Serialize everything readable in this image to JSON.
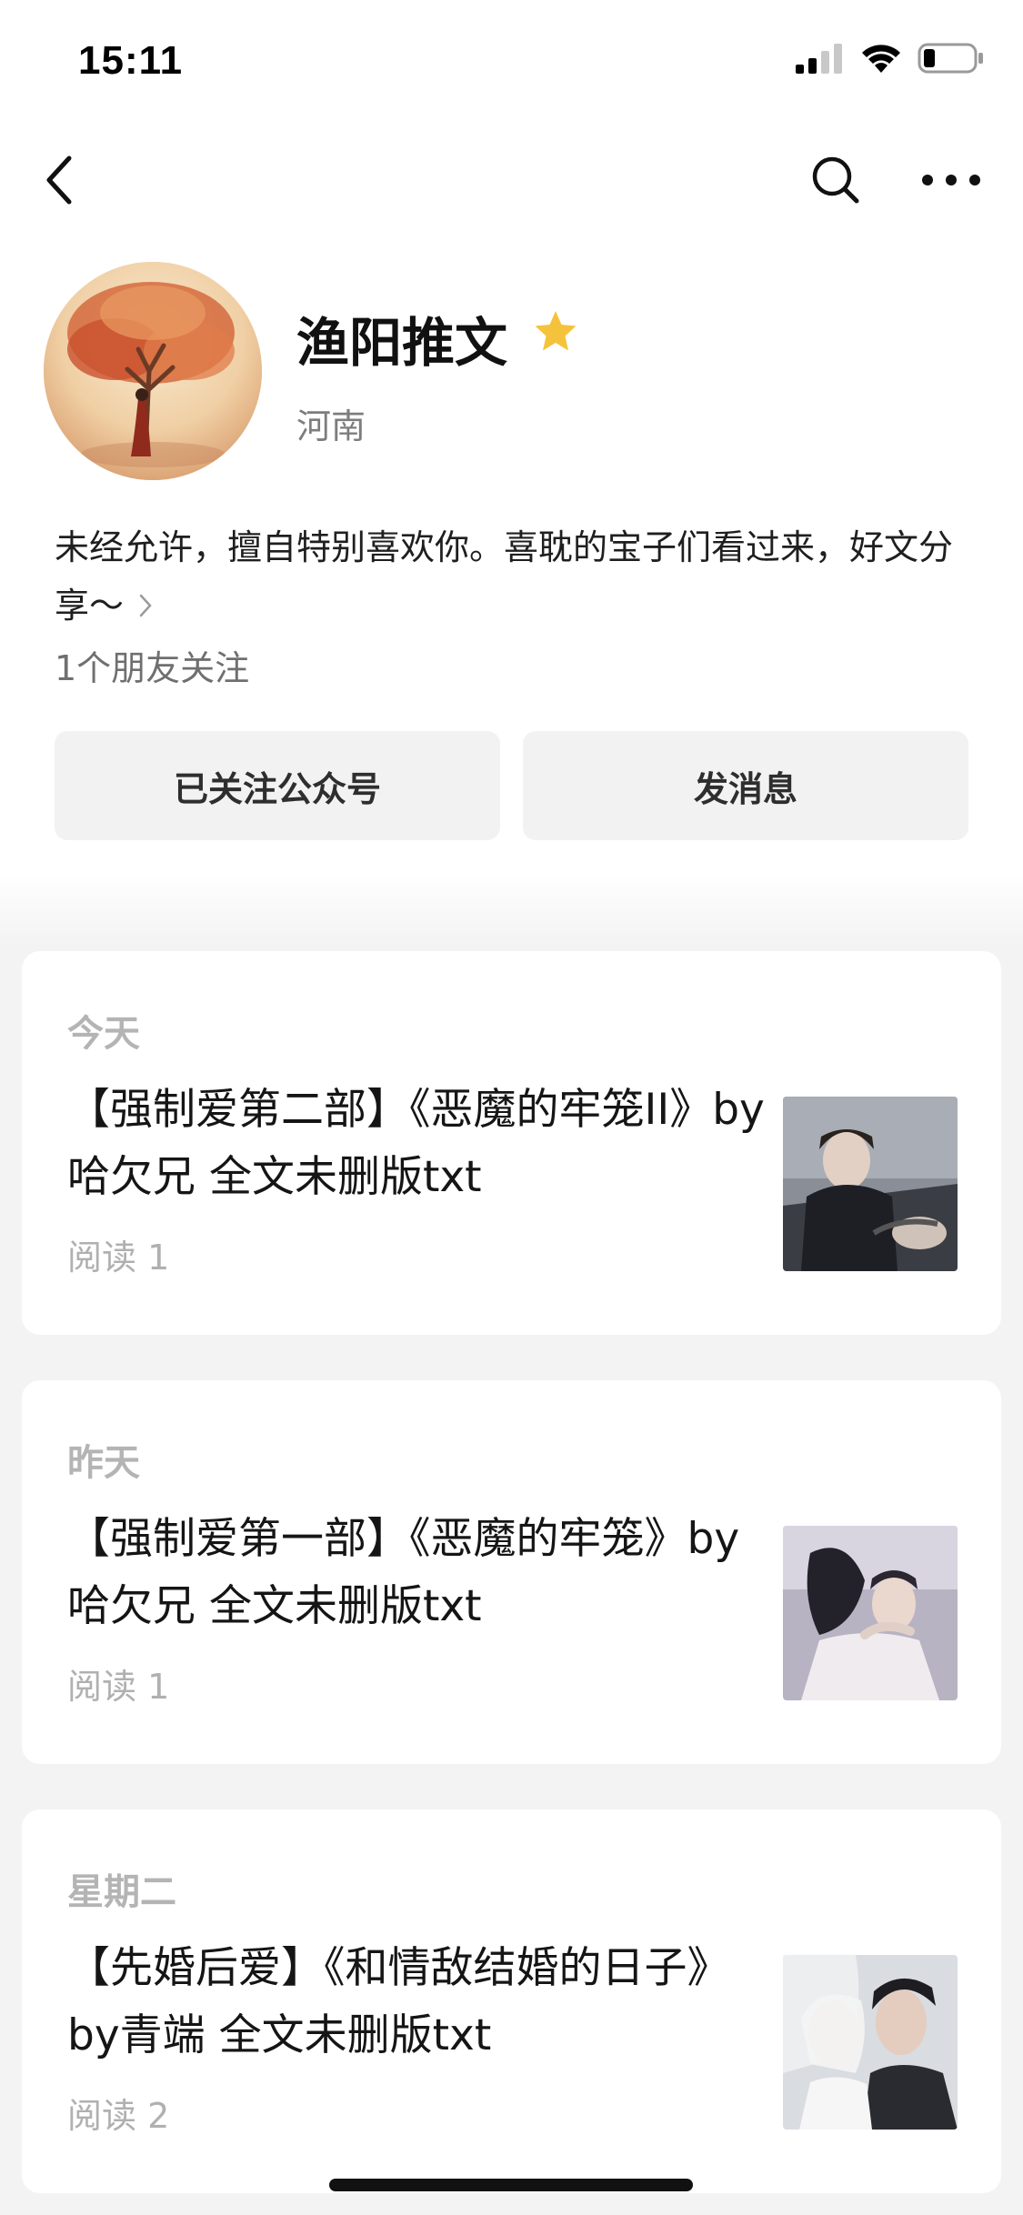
{
  "status_bar": {
    "time": "15:11"
  },
  "nav": {
    "back_icon": "chevron-left-icon",
    "search_icon": "search-icon",
    "more_icon": "more-icon"
  },
  "profile": {
    "name": "渔阳推文",
    "region": "河南",
    "description": "未经允许，擅自特别喜欢你。喜耽的宝子们看过来，好文分享～",
    "friends_follow": "1个朋友关注",
    "star_color": "#F5C33B"
  },
  "actions": {
    "follow_label": "已关注公众号",
    "message_label": "发消息"
  },
  "articles": [
    {
      "date": "今天",
      "title": "【强制爱第二部】《恶魔的牢笼II》by哈欠兄  全文未删版txt",
      "reads": "阅读 1"
    },
    {
      "date": "昨天",
      "title": "【强制爱第一部】《恶魔的牢笼》by哈欠兄  全文未删版txt",
      "reads": "阅读 1"
    },
    {
      "date": "星期二",
      "title": "【先婚后爱】《和情敌结婚的日子》by青端  全文未删版txt",
      "reads": "阅读 2"
    }
  ]
}
